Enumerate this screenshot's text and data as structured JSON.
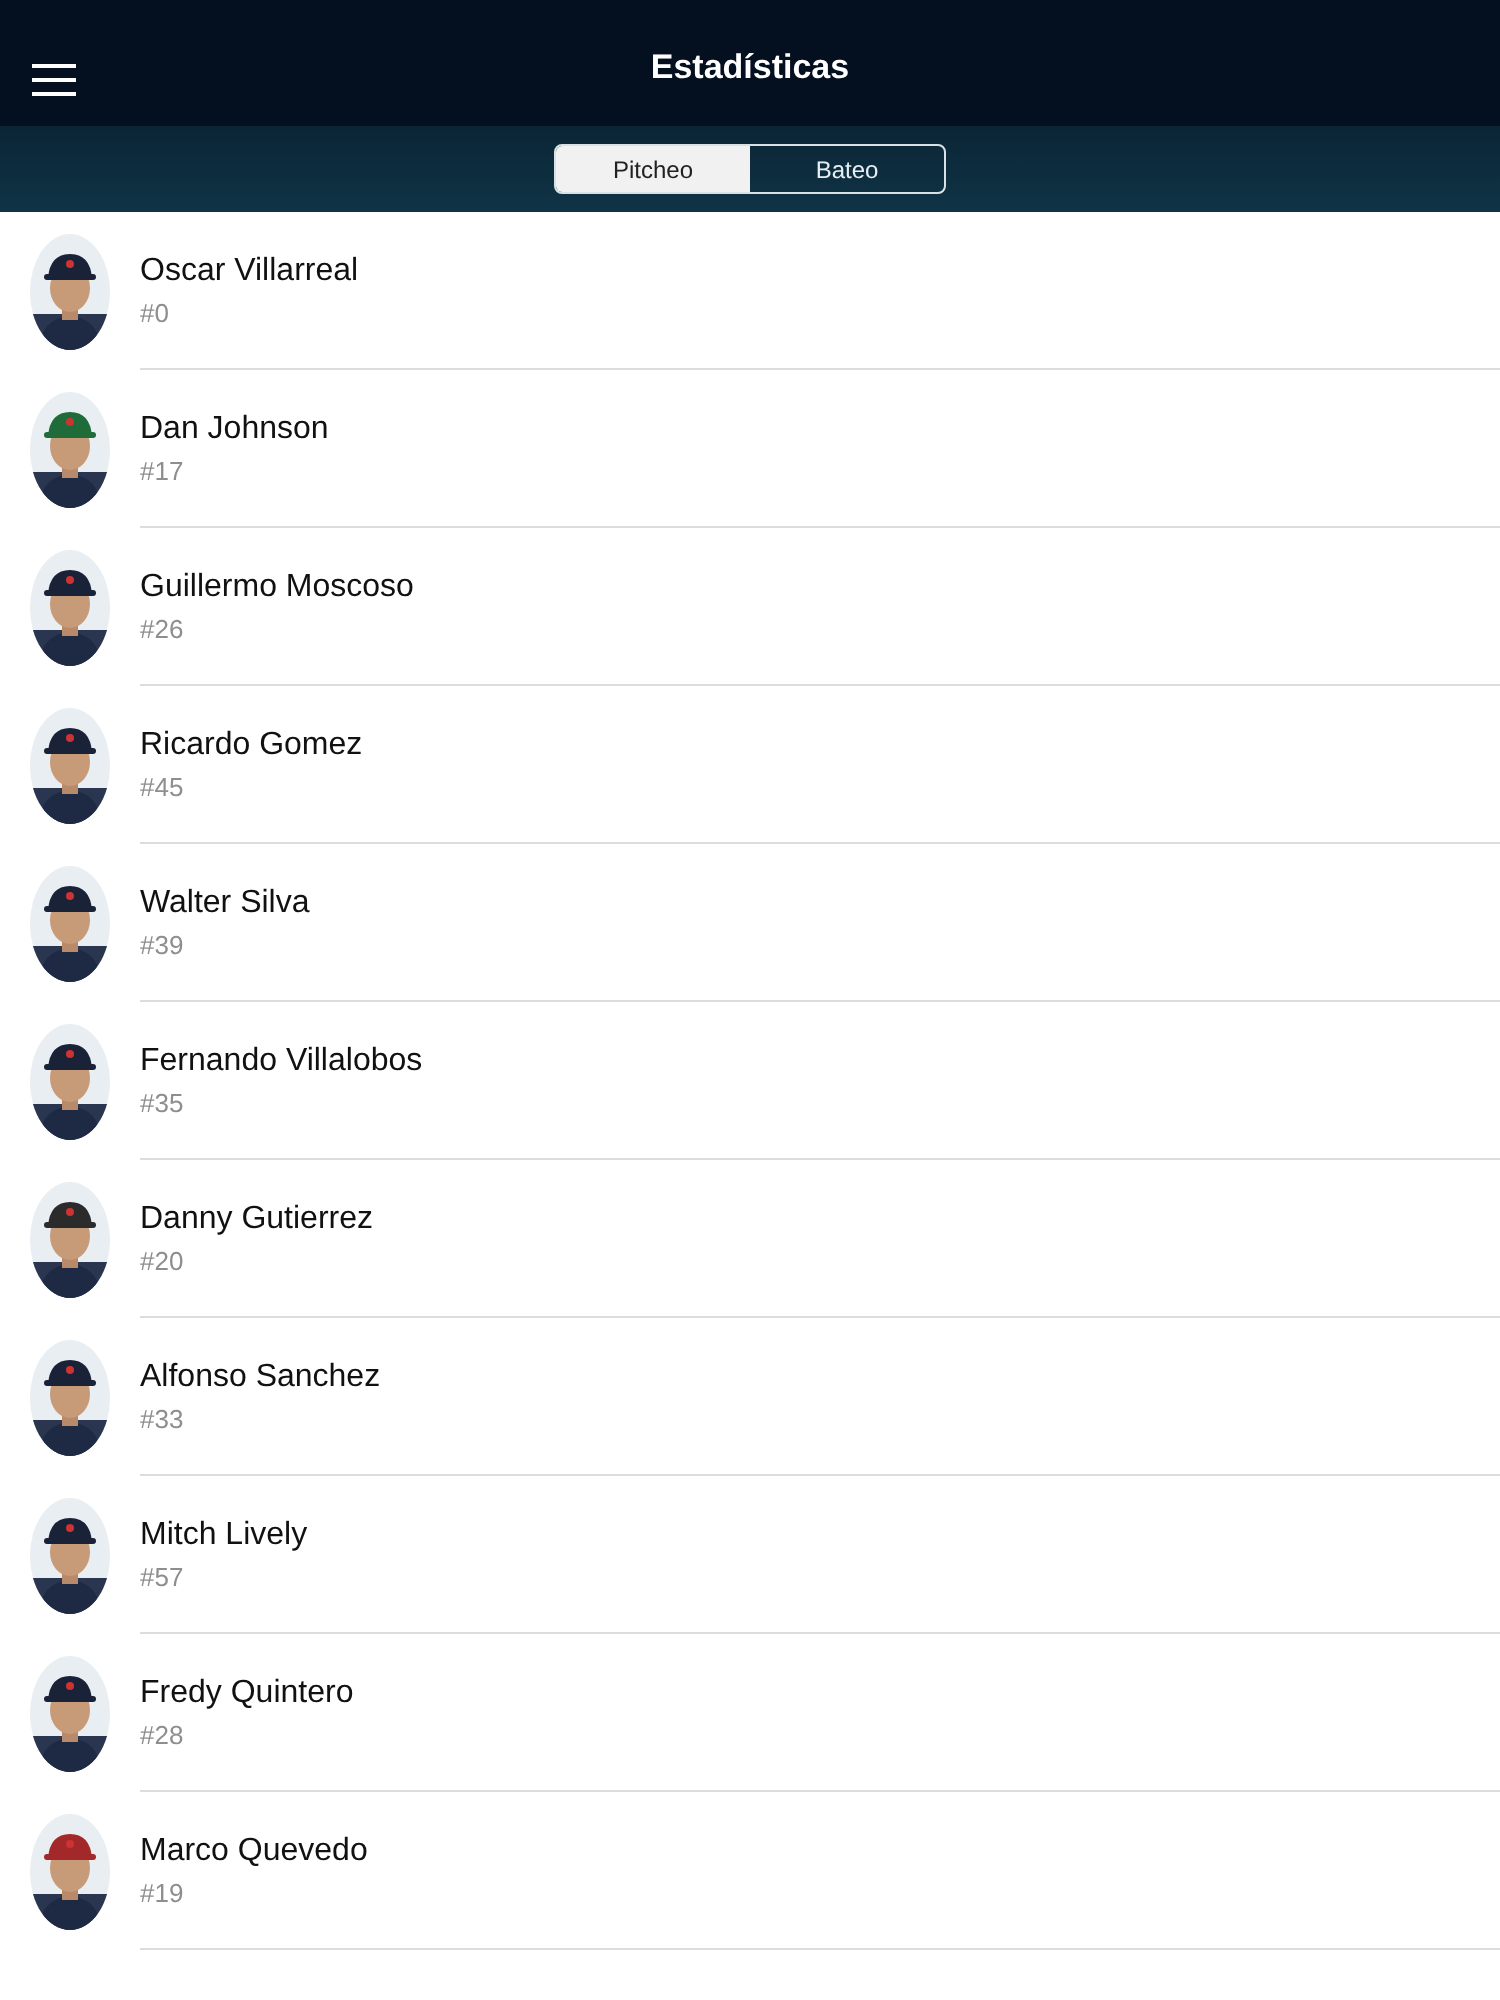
{
  "nav_bar": {
    "title": "Estadísticas"
  },
  "segments": [
    {
      "label": "Pitcheo",
      "selected": true
    },
    {
      "label": "Bateo",
      "selected": false
    }
  ],
  "players": [
    {
      "name": "Oscar Villarreal",
      "number": "#0",
      "kind": "picture"
    },
    {
      "name": "Dan Johnson",
      "number": "#17",
      "kind": "picture"
    },
    {
      "name": "Guillermo Moscoso",
      "number": "#26",
      "kind": "picture"
    },
    {
      "name": "Ricardo Gomez",
      "number": "#45",
      "kind": "picture"
    },
    {
      "name": "Walter Silva",
      "number": "#39",
      "kind": "picture"
    },
    {
      "name": "Fernando Villalobos",
      "number": "#35",
      "kind": "picture"
    },
    {
      "name": "Danny Gutierrez",
      "number": "#20",
      "kind": "picture"
    },
    {
      "name": "Alfonso Sanchez",
      "number": "#33",
      "kind": "picture"
    },
    {
      "name": "Mitch Lively",
      "number": "#57",
      "kind": "picture"
    },
    {
      "name": "Fredy Quintero",
      "number": "#28",
      "kind": "picture"
    },
    {
      "name": "Marco Quevedo",
      "number": "#19",
      "kind": "picture"
    }
  ]
}
